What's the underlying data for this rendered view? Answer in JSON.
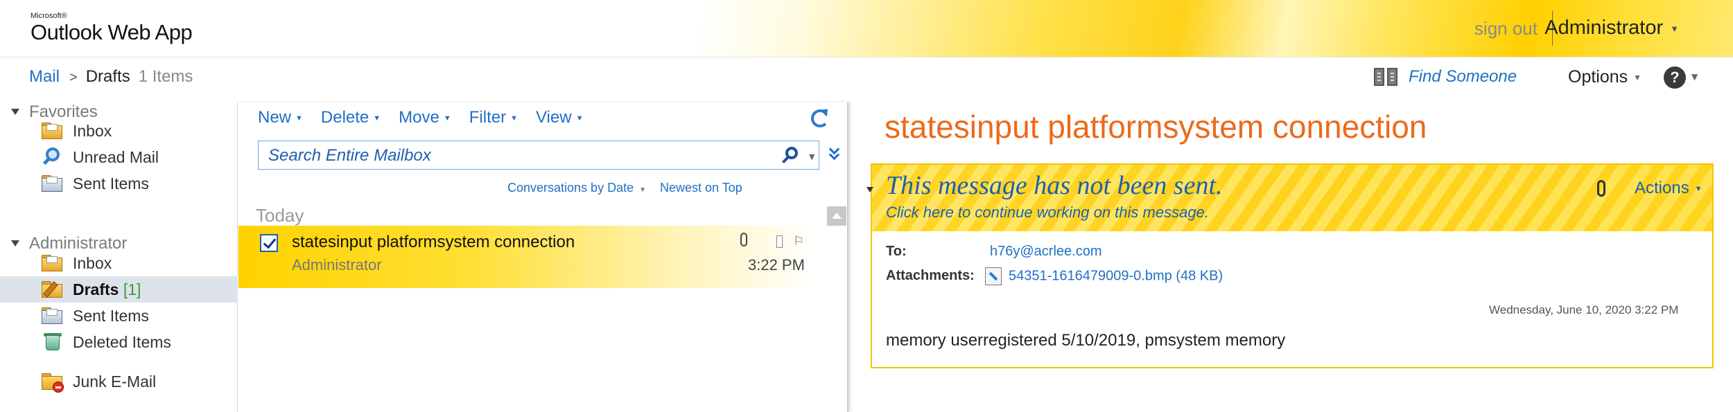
{
  "app": {
    "logo_company": "Microsoft®",
    "logo_name": "Outlook Web App",
    "signout": "sign out",
    "user": "Administrator"
  },
  "breadcrumb": {
    "root": "Mail",
    "folder": "Drafts",
    "count": "1 Items"
  },
  "topbar": {
    "find_someone": "Find Someone",
    "options": "Options",
    "help": "?"
  },
  "nav": {
    "favorites_label": "Favorites",
    "favorites": [
      {
        "label": "Inbox"
      },
      {
        "label": "Unread Mail"
      },
      {
        "label": "Sent Items"
      }
    ],
    "mailbox_label": "Administrator",
    "mailbox": [
      {
        "label": "Inbox"
      },
      {
        "label": "Drafts",
        "count": "[1]"
      },
      {
        "label": "Sent Items"
      },
      {
        "label": "Deleted Items"
      },
      {
        "label": "Junk E-Mail"
      }
    ]
  },
  "toolbar": {
    "new": "New",
    "delete": "Delete",
    "move": "Move",
    "filter": "Filter",
    "view": "View"
  },
  "search": {
    "placeholder": "Search Entire Mailbox"
  },
  "sort": {
    "arrange": "Conversations by Date",
    "order": "Newest on Top"
  },
  "list": {
    "group_label": "Today",
    "messages": [
      {
        "subject": "statesinput platformsystem connection",
        "from": "Administrator",
        "time": "3:22 PM"
      }
    ]
  },
  "reading": {
    "subject": "statesinput platformsystem connection",
    "warning": "This message has not been sent.",
    "continue_link": "Click here to continue working on this message.",
    "actions": "Actions",
    "to_label": "To:",
    "to_value": "h76y@acrlee.com",
    "attachments_label": "Attachments:",
    "attachment_name": "54351-1616479009-0.bmp (48 KB)",
    "date": "Wednesday, June 10, 2020 3:22 PM",
    "body": "memory userregistered 5/10/2019, pmsystem memory"
  },
  "colors": {
    "accent_blue": "#1f6fc5",
    "subject_orange": "#ec6a1a",
    "highlight_yellow": "#ffd200"
  }
}
